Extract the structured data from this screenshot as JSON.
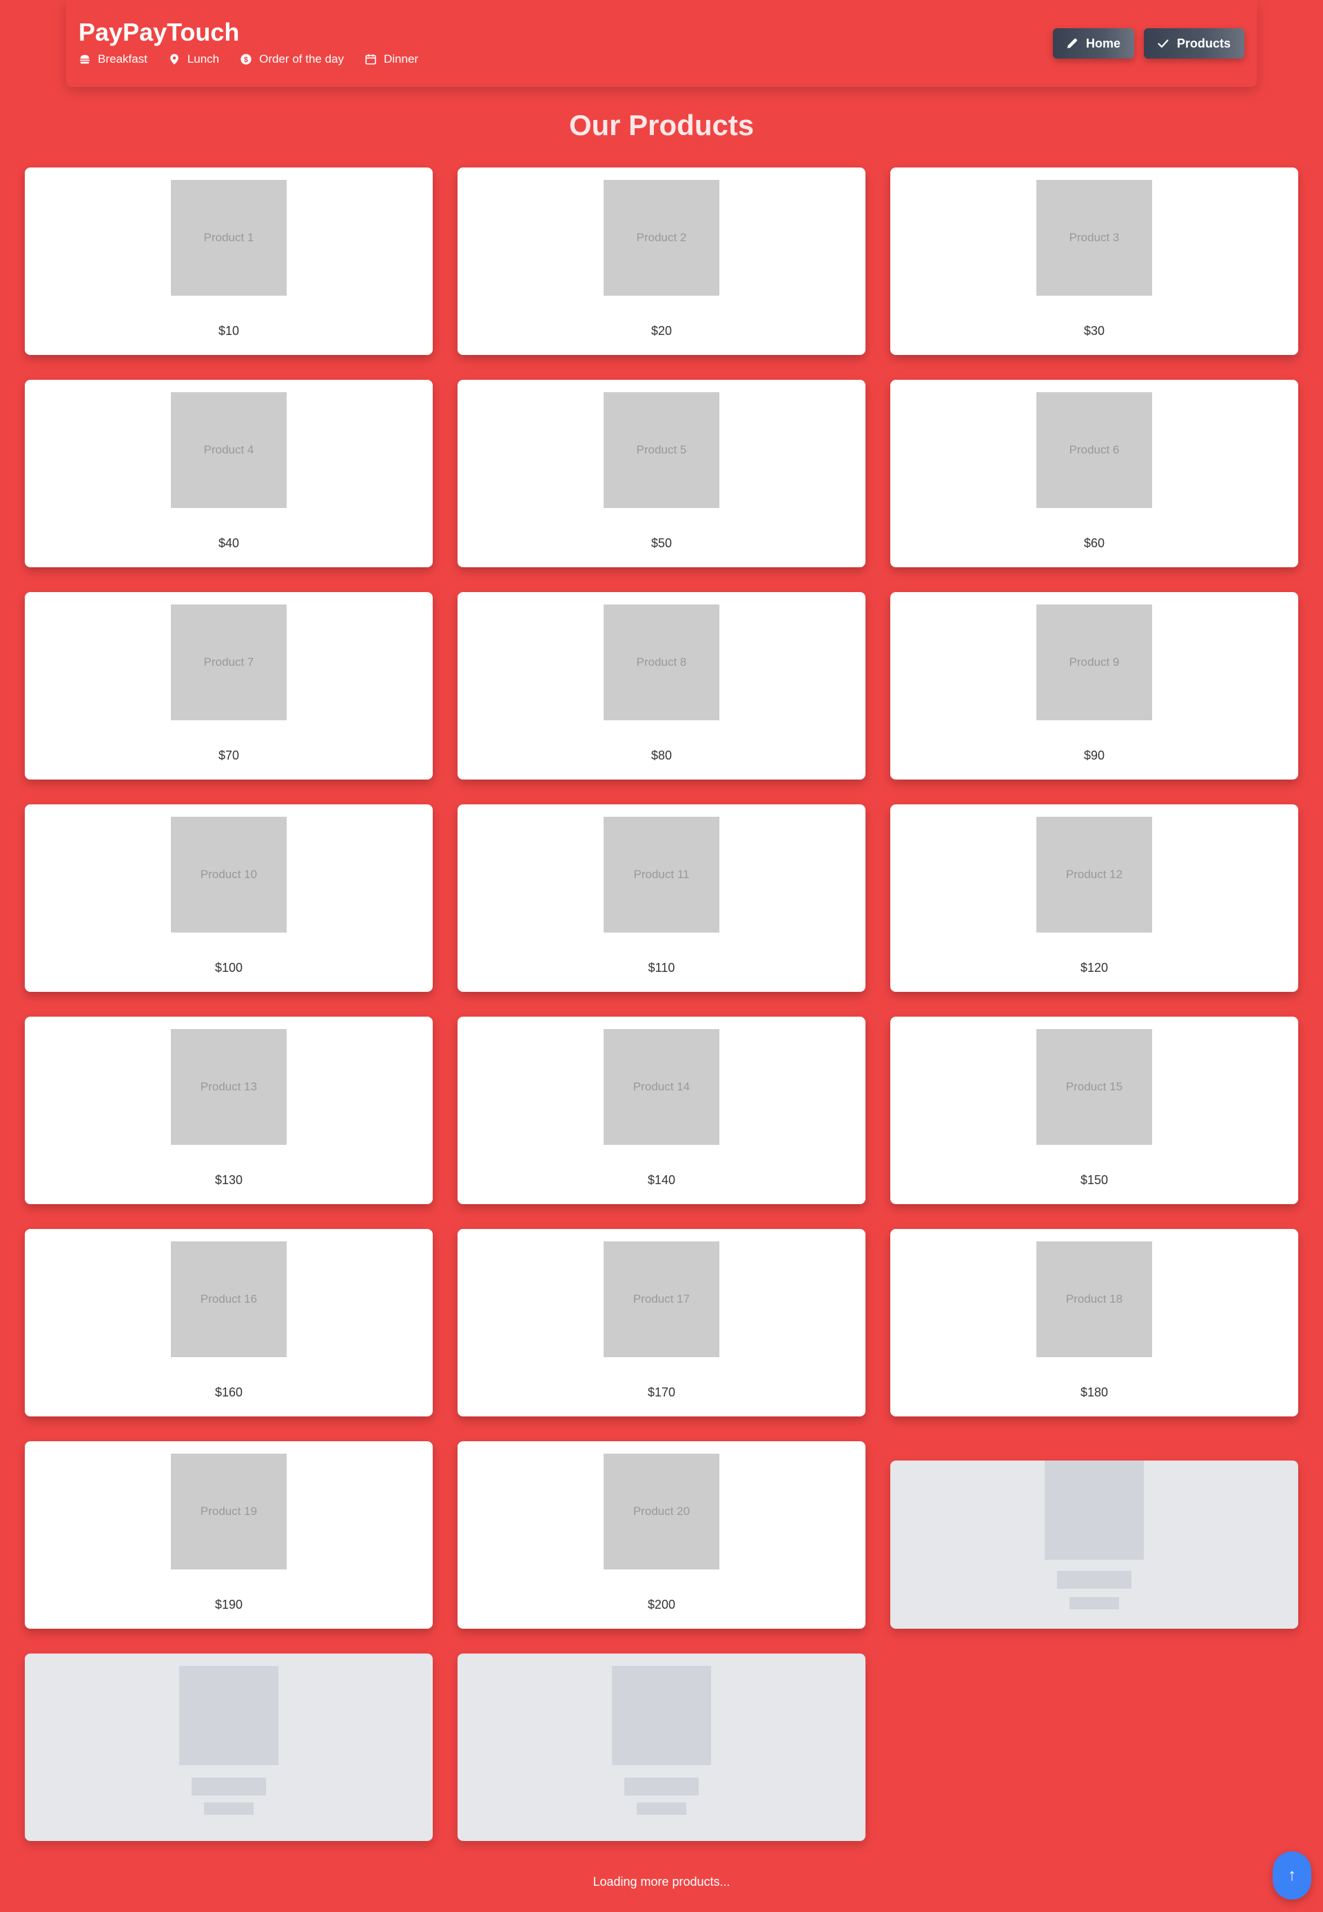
{
  "header": {
    "brand": "PayPayTouch",
    "subnav": [
      {
        "label": "Breakfast",
        "icon": "burger-icon"
      },
      {
        "label": "Lunch",
        "icon": "map-pin-icon"
      },
      {
        "label": "Order of the day",
        "icon": "dollar-circle-icon"
      },
      {
        "label": "Dinner",
        "icon": "calendar-icon"
      }
    ],
    "buttons": [
      {
        "label": "Home",
        "icon": "pencil-icon"
      },
      {
        "label": "Products",
        "icon": "check-icon"
      }
    ]
  },
  "main": {
    "title": "Our Products",
    "products": [
      {
        "name": "Product 1",
        "price": "$10"
      },
      {
        "name": "Product 2",
        "price": "$20"
      },
      {
        "name": "Product 3",
        "price": "$30"
      },
      {
        "name": "Product 4",
        "price": "$40"
      },
      {
        "name": "Product 5",
        "price": "$50"
      },
      {
        "name": "Product 6",
        "price": "$60"
      },
      {
        "name": "Product 7",
        "price": "$70"
      },
      {
        "name": "Product 8",
        "price": "$80"
      },
      {
        "name": "Product 9",
        "price": "$90"
      },
      {
        "name": "Product 10",
        "price": "$100"
      },
      {
        "name": "Product 11",
        "price": "$110"
      },
      {
        "name": "Product 12",
        "price": "$120"
      },
      {
        "name": "Product 13",
        "price": "$130"
      },
      {
        "name": "Product 14",
        "price": "$140"
      },
      {
        "name": "Product 15",
        "price": "$150"
      },
      {
        "name": "Product 16",
        "price": "$160"
      },
      {
        "name": "Product 17",
        "price": "$170"
      },
      {
        "name": "Product 18",
        "price": "$180"
      },
      {
        "name": "Product 19",
        "price": "$190"
      },
      {
        "name": "Product 20",
        "price": "$200"
      }
    ],
    "loading_text": "Loading more products..."
  },
  "scroll_top_label": "↑",
  "colors": {
    "background": "#ef4444",
    "card": "#ffffff",
    "placeholder": "#cccccc",
    "skeleton": "#e5e7eb",
    "skeleton_block": "#d1d5db",
    "button_dark": "#374151",
    "scroll_top": "#3b82f6"
  }
}
